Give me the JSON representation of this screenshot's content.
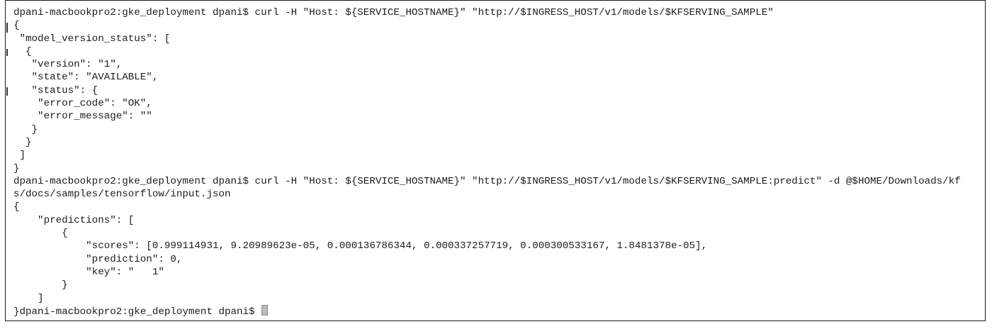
{
  "terminal": {
    "lines": [
      "dpani-macbookpro2:gke_deployment dpani$ curl -H \"Host: ${SERVICE_HOSTNAME}\" \"http://$INGRESS_HOST/v1/models/$KFSERVING_SAMPLE\"",
      "{",
      " \"model_version_status\": [",
      "  {",
      "   \"version\": \"1\",",
      "   \"state\": \"AVAILABLE\",",
      "   \"status\": {",
      "    \"error_code\": \"OK\",",
      "    \"error_message\": \"\"",
      "   }",
      "  }",
      " ]",
      "}",
      "dpani-macbookpro2:gke_deployment dpani$ curl -H \"Host: ${SERVICE_HOSTNAME}\" \"http://$INGRESS_HOST/v1/models/$KFSERVING_SAMPLE:predict\" -d @$HOME/Downloads/kf",
      "s/docs/samples/tensorflow/input.json",
      "{",
      "    \"predictions\": [",
      "        {",
      "            \"scores\": [0.999114931, 9.20989623e-05, 0.000136786344, 0.000337257719, 0.000300533167, 1.8481378e-05],",
      "            \"prediction\": 0,",
      "            \"key\": \"   1\"",
      "        }",
      "    ]",
      "}dpani-macbookpro2:gke_deployment dpani$ "
    ]
  }
}
